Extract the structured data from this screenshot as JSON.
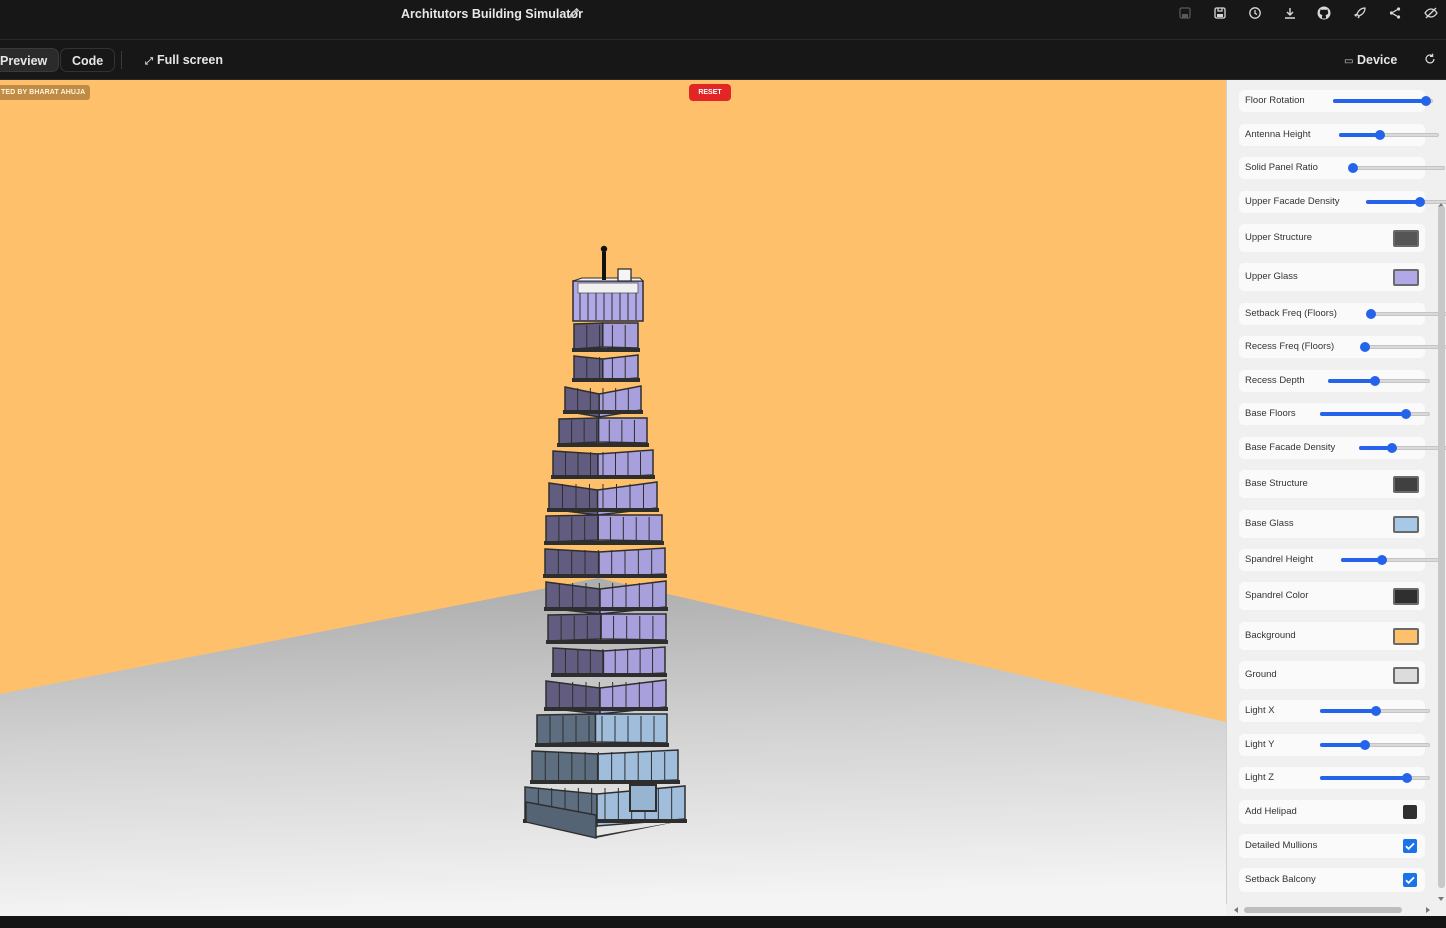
{
  "topbar": {
    "title": "Architutors Building Simulator",
    "icons": [
      "save-icon",
      "save-as-icon",
      "history-icon",
      "download-icon",
      "github-icon",
      "deploy-rocket-icon",
      "share-icon",
      "hide-panel-icon"
    ]
  },
  "toolbar": {
    "preview_label": "Preview",
    "code_label": "Code",
    "fullscreen_label": "Full screen",
    "device_label": "Device"
  },
  "viewport": {
    "credit": "TED BY BHARAT AHUJA",
    "reset_label": "RESET",
    "background_color": "#ffc06b",
    "ground_color": "#d8d8d8"
  },
  "controls": {
    "floor_rotation": {
      "label": "Floor Rotation",
      "value": 0.92
    },
    "antenna_height": {
      "label": "Antenna Height",
      "value": 0.4
    },
    "solid_panel_ratio": {
      "label": "Solid Panel Ratio",
      "value": 0.03
    },
    "upper_facade_density": {
      "label": "Upper Facade Density",
      "value": 0.62
    },
    "upper_structure": {
      "label": "Upper Structure",
      "color": "#555555"
    },
    "upper_glass": {
      "label": "Upper Glass",
      "color": "#b1a8e8"
    },
    "setback_freq": {
      "label": "Setback Freq (Floors)",
      "value": 0.02
    },
    "recess_freq": {
      "label": "Recess Freq (Floors)",
      "value": 0.02
    },
    "recess_depth": {
      "label": "Recess Depth",
      "value": 0.45
    },
    "base_floors": {
      "label": "Base Floors",
      "value": 0.77
    },
    "base_facade_density": {
      "label": "Base Facade Density",
      "value": 0.35
    },
    "base_structure": {
      "label": "Base Structure",
      "color": "#404040"
    },
    "base_glass": {
      "label": "Base Glass",
      "color": "#a8c8e8"
    },
    "spandrel_height": {
      "label": "Spandrel Height",
      "value": 0.4
    },
    "spandrel_color": {
      "label": "Spandrel Color",
      "color": "#2f2f2f"
    },
    "background": {
      "label": "Background",
      "color": "#ffc06b"
    },
    "ground": {
      "label": "Ground",
      "color": "#dcdcdc"
    },
    "light_x": {
      "label": "Light X",
      "value": 0.5
    },
    "light_y": {
      "label": "Light Y",
      "value": 0.4
    },
    "light_z": {
      "label": "Light Z",
      "value": 0.78
    },
    "add_helipad": {
      "label": "Add Helipad",
      "checked": false
    },
    "detailed_mullions": {
      "label": "Detailed Mullions",
      "checked": true
    },
    "setback_balcony": {
      "label": "Setback Balcony",
      "checked": true
    }
  }
}
